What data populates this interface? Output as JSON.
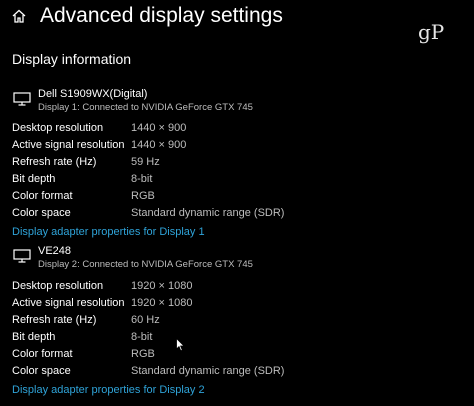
{
  "header": {
    "title": "Advanced display settings",
    "home_icon": "home-icon",
    "watermark": "gP"
  },
  "section": {
    "title": "Display information"
  },
  "displays": [
    {
      "name": "Dell S1909WX(Digital)",
      "subtitle": "Display 1: Connected to NVIDIA GeForce GTX 745",
      "icon": "monitor-icon",
      "rows": [
        {
          "label": "Desktop resolution",
          "value": "1440 × 900"
        },
        {
          "label": "Active signal resolution",
          "value": "1440 × 900"
        },
        {
          "label": "Refresh rate (Hz)",
          "value": "59 Hz"
        },
        {
          "label": "Bit depth",
          "value": "8-bit"
        },
        {
          "label": "Color format",
          "value": "RGB"
        },
        {
          "label": "Color space",
          "value": "Standard dynamic range (SDR)"
        }
      ],
      "link": "Display adapter properties for Display 1"
    },
    {
      "name": "VE248",
      "subtitle": "Display 2: Connected to NVIDIA GeForce GTX 745",
      "icon": "monitor-icon",
      "rows": [
        {
          "label": "Desktop resolution",
          "value": "1920 × 1080"
        },
        {
          "label": "Active signal resolution",
          "value": "1920 × 1080"
        },
        {
          "label": "Refresh rate (Hz)",
          "value": "60 Hz"
        },
        {
          "label": "Bit depth",
          "value": "8-bit"
        },
        {
          "label": "Color format",
          "value": "RGB"
        },
        {
          "label": "Color space",
          "value": "Standard dynamic range (SDR)"
        }
      ],
      "link": "Display adapter properties for Display 2"
    }
  ],
  "colors": {
    "background": "#000000",
    "text": "#ffffff",
    "secondary_text": "#bdbdbd",
    "link": "#2fa3d8"
  }
}
